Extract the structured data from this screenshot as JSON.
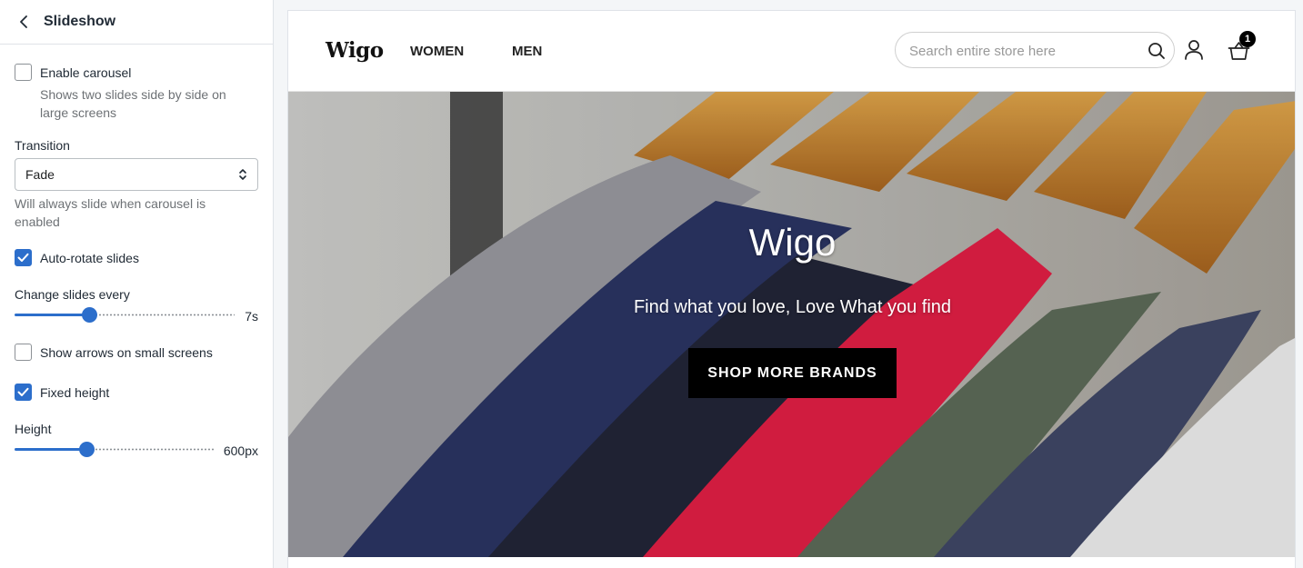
{
  "sidebar": {
    "title": "Slideshow",
    "enable_carousel": {
      "label": "Enable carousel",
      "checked": false,
      "help": "Shows two slides side by side on large screens"
    },
    "transition": {
      "label": "Transition",
      "value": "Fade",
      "help": "Will always slide when carousel is enabled"
    },
    "auto_rotate": {
      "label": "Auto-rotate slides",
      "checked": true
    },
    "change_slides": {
      "label": "Change slides every",
      "value_text": "7s",
      "fraction": 0.33
    },
    "show_arrows": {
      "label": "Show arrows on small screens",
      "checked": false
    },
    "fixed_height": {
      "label": "Fixed height",
      "checked": true
    },
    "height": {
      "label": "Height",
      "value_text": "600px",
      "fraction": 0.35
    }
  },
  "store": {
    "logo": "Wigo",
    "nav": [
      "WOMEN",
      "MEN"
    ],
    "search_placeholder": "Search entire store here",
    "cart_count": "1"
  },
  "hero": {
    "title": "Wigo",
    "subtitle": "Find what you love, Love What you find",
    "button": "SHOP MORE BRANDS"
  },
  "colors": {
    "accent": "#2c6ecb",
    "hero_button": "#000000"
  },
  "icons": [
    "chevron-left-icon",
    "chevron-updown-icon",
    "checkmark-icon",
    "search-icon",
    "account-icon",
    "basket-icon"
  ]
}
